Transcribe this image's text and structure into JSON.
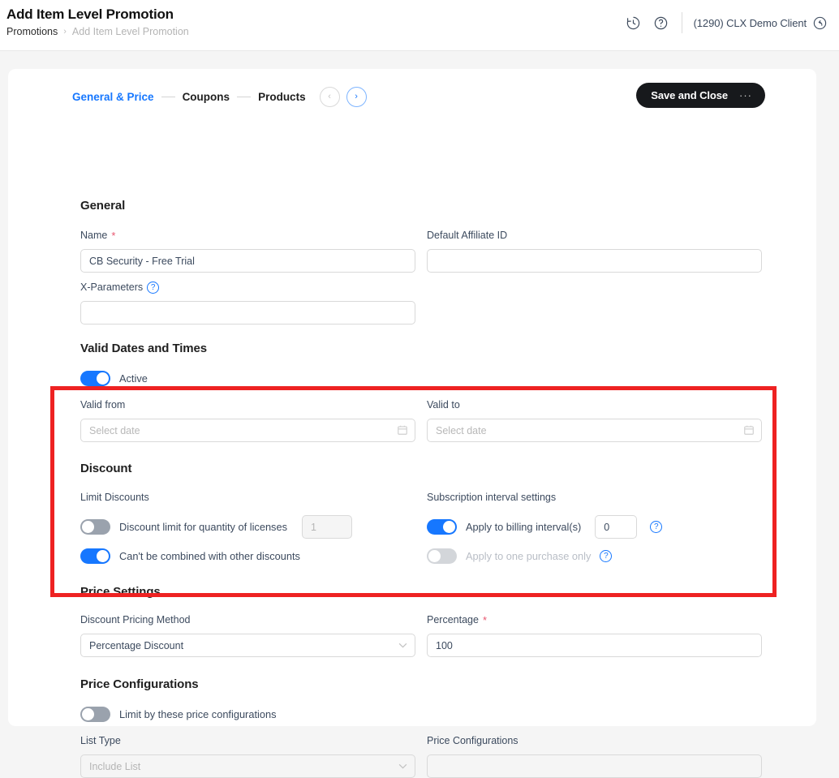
{
  "header": {
    "title": "Add Item Level Promotion",
    "breadcrumb": {
      "parent": "Promotions",
      "separator": "›",
      "current": "Add Item Level Promotion"
    },
    "history_icon": "history-clock-icon",
    "help_icon": "help-question-icon",
    "client_label": "(1290) CLX Demo Client",
    "client_back_icon": "undo-arrow-icon"
  },
  "tabs": {
    "items": [
      {
        "label": "General & Price",
        "active": true
      },
      {
        "label": "Coupons",
        "active": false
      },
      {
        "label": "Products",
        "active": false
      }
    ],
    "prev_label": "‹",
    "next_label": "›"
  },
  "toolbar": {
    "save_label": "Save and Close",
    "overflow_label": "···"
  },
  "general": {
    "title": "General",
    "name_label": "Name",
    "name_required": "*",
    "name_value": "CB Security - Free Trial",
    "affiliate_label": "Default Affiliate ID",
    "affiliate_value": "",
    "xparams_label": "X-Parameters",
    "xparams_value": "",
    "xparams_help": "?"
  },
  "valid_dates": {
    "title": "Valid Dates and Times",
    "active_label": "Active",
    "active_on": true,
    "valid_from_label": "Valid from",
    "valid_from_placeholder": "Select date",
    "valid_to_label": "Valid to",
    "valid_to_placeholder": "Select date",
    "calendar_icon": "calendar-icon"
  },
  "discount": {
    "title": "Discount",
    "limit_discounts_label": "Limit Discounts",
    "quantity_toggle_label": "Discount limit for quantity of licenses",
    "quantity_toggle_on": false,
    "quantity_value": "1",
    "combine_toggle_label": "Can't be combined with other discounts",
    "combine_toggle_on": true,
    "subscription_label": "Subscription interval settings",
    "billing_toggle_label": "Apply to billing interval(s)",
    "billing_toggle_on": true,
    "billing_value": "0",
    "billing_help": "?",
    "one_purchase_label": "Apply to one purchase only",
    "one_purchase_on": false,
    "one_purchase_help": "?"
  },
  "price_settings": {
    "title": "Price Settings",
    "method_label": "Discount Pricing Method",
    "method_value": "Percentage Discount",
    "percentage_label": "Percentage",
    "percentage_required": "*",
    "percentage_value": "100"
  },
  "price_configurations": {
    "title": "Price Configurations",
    "limit_toggle_label": "Limit by these price configurations",
    "limit_toggle_on": false,
    "list_type_label": "List Type",
    "list_type_value": "Include List",
    "configs_label": "Price Configurations",
    "configs_value": ""
  },
  "colors": {
    "accent": "#1677ff",
    "highlight": "#ee2222",
    "save_button": "#17191c",
    "required": "#e8566f"
  }
}
